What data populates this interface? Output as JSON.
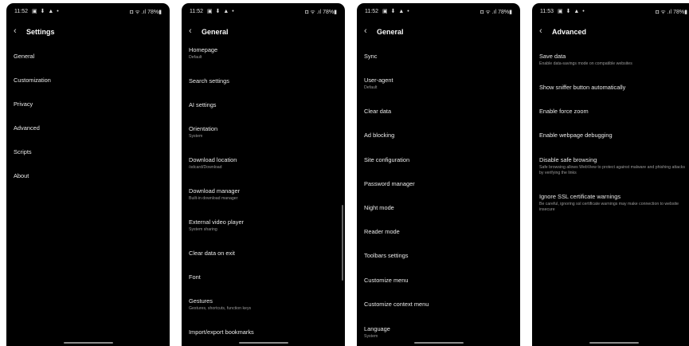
{
  "screens": [
    {
      "time": "11:52",
      "status_icons": "▣ ⬇ ▲ •",
      "status_right": "78%",
      "title": "Settings",
      "items": [
        {
          "label": "General",
          "sub": ""
        },
        {
          "label": "Customization",
          "sub": ""
        },
        {
          "label": "Privacy",
          "sub": ""
        },
        {
          "label": "Advanced",
          "sub": ""
        },
        {
          "label": "Scripts",
          "sub": ""
        },
        {
          "label": "About",
          "sub": ""
        }
      ]
    },
    {
      "time": "11:52",
      "status_icons": "▣ ⬇ ▲ •",
      "status_right": "78%",
      "title": "General",
      "items": [
        {
          "label": "Homepage",
          "sub": "Default"
        },
        {
          "label": "Search settings",
          "sub": ""
        },
        {
          "label": "AI settings",
          "sub": ""
        },
        {
          "label": "Orientation",
          "sub": "System"
        },
        {
          "label": "Download location",
          "sub": "/sdcard/Download"
        },
        {
          "label": "Download manager",
          "sub": "Built-in download manager"
        },
        {
          "label": "External video player",
          "sub": "System sharing"
        },
        {
          "label": "Clear data on exit",
          "sub": ""
        },
        {
          "label": "Font",
          "sub": ""
        },
        {
          "label": "Gestures",
          "sub": "Gestures, shortcuts, function keys"
        },
        {
          "label": "Import/export bookmarks",
          "sub": ""
        }
      ]
    },
    {
      "time": "11:52",
      "status_icons": "▣ ⬇ ▲ •",
      "status_right": "78%",
      "title": "General",
      "items": [
        {
          "label": "Sync",
          "sub": ""
        },
        {
          "label": "User-agent",
          "sub": "Default"
        },
        {
          "label": "Clear data",
          "sub": ""
        },
        {
          "label": "Ad blocking",
          "sub": ""
        },
        {
          "label": "Site configuration",
          "sub": ""
        },
        {
          "label": "Password manager",
          "sub": ""
        },
        {
          "label": "Night mode",
          "sub": ""
        },
        {
          "label": "Reader mode",
          "sub": ""
        },
        {
          "label": "Toolbars settings",
          "sub": ""
        },
        {
          "label": "Customize menu",
          "sub": ""
        },
        {
          "label": "Customize context menu",
          "sub": ""
        },
        {
          "label": "Language",
          "sub": "System"
        }
      ]
    },
    {
      "time": "11:53",
      "status_icons": "▣ ⬇ ▲ •",
      "status_right": "78%",
      "title": "Advanced",
      "items": [
        {
          "label": "Save data",
          "sub": "Enable data-savings mode on compatible websites"
        },
        {
          "label": "Show sniffer button automatically",
          "sub": ""
        },
        {
          "label": "Enable force zoom",
          "sub": ""
        },
        {
          "label": "Enable webpage debugging",
          "sub": ""
        },
        {
          "label": "Disable safe browsing",
          "sub": "Safe browsing allows WebView to protect against malware and phishing attacks by verifying the links"
        },
        {
          "label": "Ignore SSL certificate warnings",
          "sub": "Be careful, ignoring ssl certificate warnings may make connection to website insecure"
        }
      ]
    }
  ]
}
